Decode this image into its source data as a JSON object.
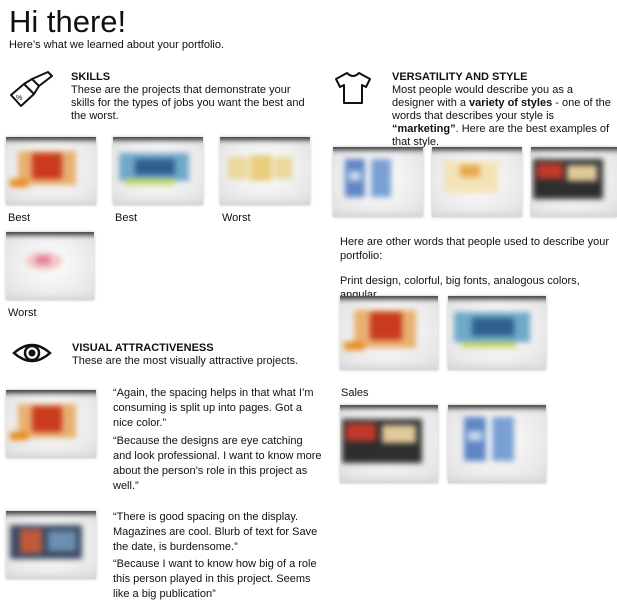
{
  "header": {
    "title": "Hi there!",
    "subtitle": "Here’s what we learned about your portfolio."
  },
  "skills": {
    "icon": "paintbrush-icon",
    "title": "SKILLS",
    "description": "These are the projects that demonstrate your skills for the types of jobs you want the best and the worst.",
    "captions": [
      "Best",
      "Best",
      "Worst",
      "Worst"
    ]
  },
  "visual": {
    "icon": "eye-icon",
    "title": "VISUAL ATTRACTIVENESS",
    "description": "These are the most visually attractive projects.",
    "quotes": [
      {
        "q1": "“Again, the spacing helps in that what I’m consuming is split up into pages. Got a nice color.”",
        "q2": "“Because the designs are eye catching and look professional. I want to know more about the person’s role in this project as well.”"
      },
      {
        "q1": "“There is good spacing on the display. Magazines are cool. Blurb of text for Save the date, is burdensome.”",
        "q2": "“Because I want to know how big of a role this person played in this project. Seems like a big publication”"
      }
    ]
  },
  "versatility": {
    "icon": "tshirt-icon",
    "title": "VERSATILITY AND STYLE",
    "desc_pre": "Most people would describe you as a designer with a ",
    "desc_bold1": "variety of styles",
    "desc_mid": " - one of the words that describes your style is ",
    "desc_bold2": "“marketing”",
    "desc_post": ". Here are the best examples of that style.",
    "other_words_intro": "Here are other words that people used to describe your portfolio:",
    "other_words": "Print design, colorful, big fonts, analogous colors, angular",
    "sales_label": "Sales"
  }
}
